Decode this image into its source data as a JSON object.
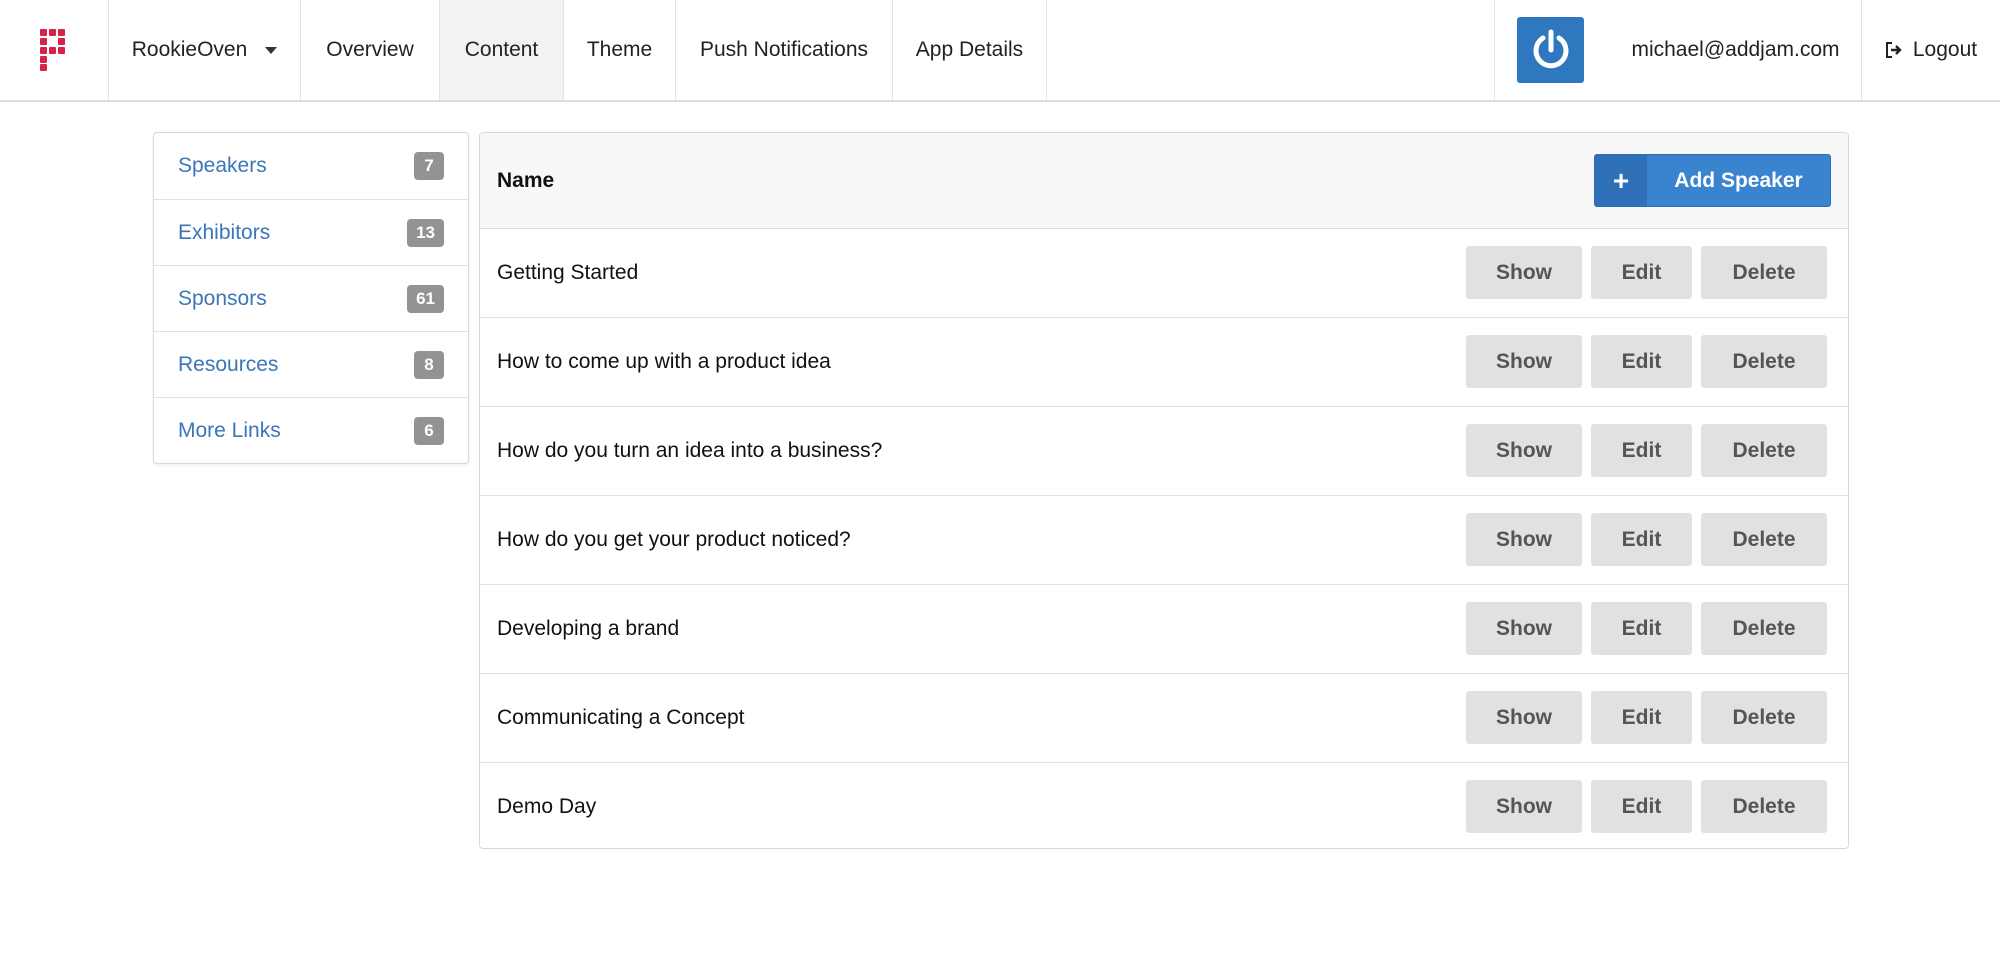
{
  "nav": {
    "app_selector": "RookieOven",
    "items": [
      "Overview",
      "Content",
      "Theme",
      "Push Notifications",
      "App Details"
    ],
    "active": "Content",
    "user_email": "michael@addjam.com",
    "logout_label": "Logout"
  },
  "sidebar": {
    "items": [
      {
        "label": "Speakers",
        "count": "7"
      },
      {
        "label": "Exhibitors",
        "count": "13"
      },
      {
        "label": "Sponsors",
        "count": "61"
      },
      {
        "label": "Resources",
        "count": "8"
      },
      {
        "label": "More Links",
        "count": "6"
      }
    ]
  },
  "table": {
    "column_name": "Name",
    "add_label": "Add Speaker",
    "add_icon": "+",
    "actions": {
      "show": "Show",
      "edit": "Edit",
      "delete": "Delete"
    },
    "rows": [
      "Getting Started",
      "How to come up with a product idea",
      "How do you turn an idea into a business?",
      "How do you get your product noticed?",
      "Developing a brand",
      "Communicating a Concept",
      "Demo Day"
    ]
  },
  "colors": {
    "accent": "#3a83cf",
    "logo": "#d6234a",
    "link": "#3a76b8",
    "badge": "#939393"
  },
  "icons": {
    "logo": "brand-logo-icon",
    "power": "power-icon",
    "logout": "logout-icon",
    "caret": "caret-down-icon"
  }
}
